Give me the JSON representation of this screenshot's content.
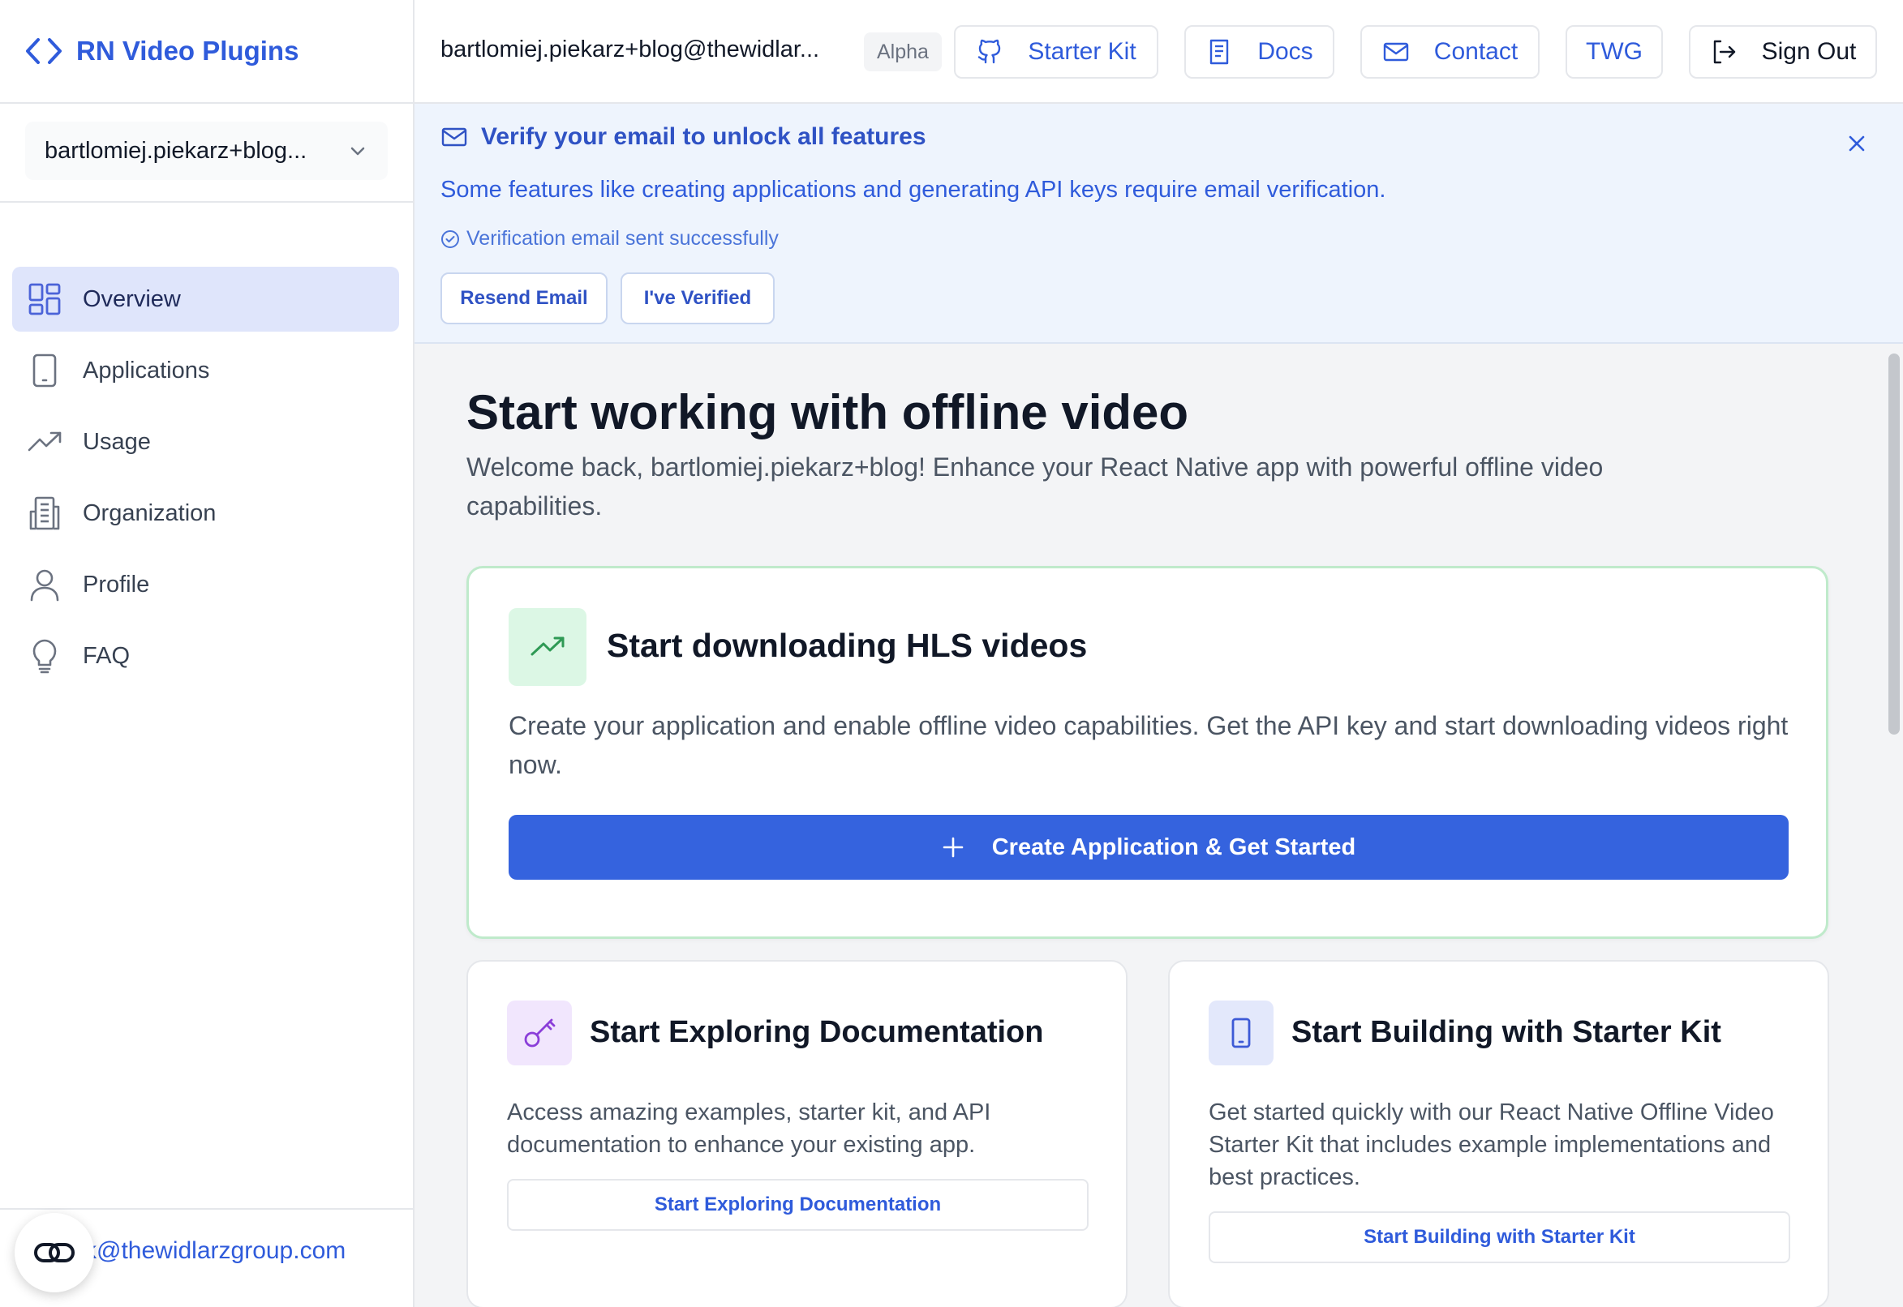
{
  "brand": {
    "name": "RN Video Plugins",
    "icon": "code-brackets-icon"
  },
  "sidebar": {
    "org_select": {
      "value": "bartlomiej.piekarz+blog..."
    },
    "items": [
      {
        "label": "Overview",
        "icon": "grid-icon",
        "active": true
      },
      {
        "label": "Applications",
        "icon": "smartphone-icon"
      },
      {
        "label": "Usage",
        "icon": "trending-up-icon"
      },
      {
        "label": "Organization",
        "icon": "building-icon"
      },
      {
        "label": "Profile",
        "icon": "user-icon"
      },
      {
        "label": "FAQ",
        "icon": "lightbulb-icon"
      }
    ],
    "footer_email": "k@thewidlarzgroup.com"
  },
  "topbar": {
    "user_email": "bartlomiej.piekarz+blog@thewidlar...",
    "badge": "Alpha",
    "buttons": {
      "starter_kit": "Starter Kit",
      "docs": "Docs",
      "contact": "Contact",
      "twg": "TWG",
      "sign_out": "Sign Out"
    }
  },
  "banner": {
    "title": "Verify your email to unlock all features",
    "description": "Some features like creating applications and generating API keys require email verification.",
    "status": "Verification email sent successfully",
    "resend_label": "Resend Email",
    "verified_label": "I've Verified"
  },
  "main": {
    "title": "Start working with offline video",
    "subtitle": "Welcome back, bartlomiej.piekarz+blog! Enhance your React Native app with powerful offline video capabilities.",
    "hero": {
      "title": "Start downloading HLS videos",
      "description": "Create your application and enable offline video capabilities. Get the API key and start downloading videos right now.",
      "button": "Create Application & Get Started"
    },
    "cards": [
      {
        "title": "Start Exploring Documentation",
        "description": "Access amazing examples, starter kit, and API documentation to enhance your existing app.",
        "button": "Start Exploring Documentation",
        "icon": "key-icon"
      },
      {
        "title": "Start Building with Starter Kit",
        "description": "Get started quickly with our React Native Offline Video Starter Kit that includes example implementations and best practices.",
        "button": "Start Building with Starter Kit",
        "icon": "smartphone-icon"
      }
    ]
  },
  "colors": {
    "accent": "#2f5bdb",
    "primary_button": "#3563de",
    "active_nav": "#dfe5fb",
    "banner_bg": "#eef4fd",
    "hero_border": "#bfeacb"
  }
}
